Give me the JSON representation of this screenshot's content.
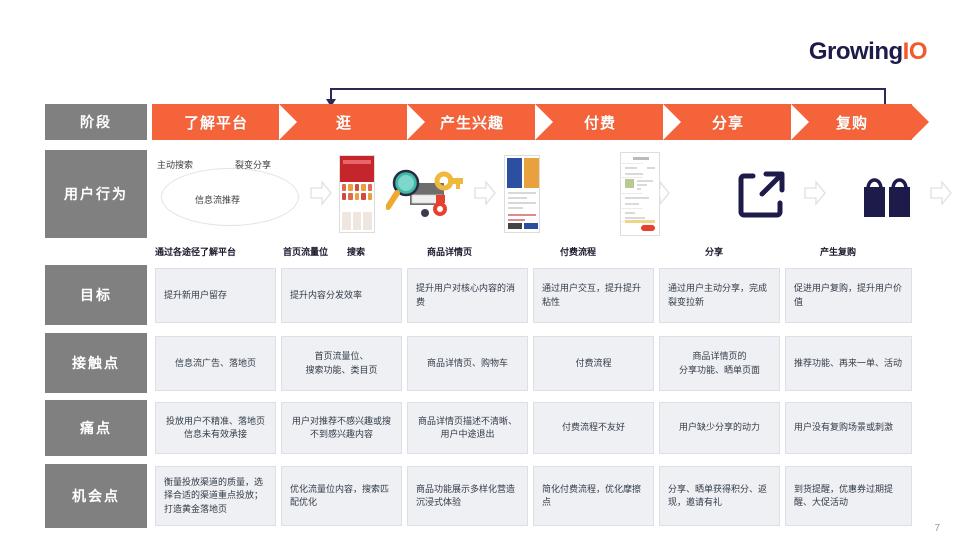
{
  "logo": {
    "part1": "Growing",
    "part2": "IO"
  },
  "page_number": "7",
  "row_labels": [
    {
      "name": "stage",
      "label": "阶段"
    },
    {
      "name": "behaviour",
      "label": "用户行为"
    },
    {
      "name": "goal",
      "label": "目标"
    },
    {
      "name": "touchpoint",
      "label": "接触点"
    },
    {
      "name": "painpoint",
      "label": "痛点"
    },
    {
      "name": "opportunity",
      "label": "机会点"
    }
  ],
  "stages": [
    "了解平台",
    "逛",
    "产生兴趣",
    "付费",
    "分享",
    "复购"
  ],
  "behaviour": {
    "bubble": {
      "t1": "主动搜索",
      "t2": "裂变分享",
      "t3": "信息流推荐"
    },
    "captions": [
      "通过各途径了解平台",
      "首页流量位",
      "搜索",
      "商品详情页",
      "付费流程",
      "分享",
      "产生复购"
    ],
    "icons": [
      "behaviour-bubble",
      "phone-homepage-mock",
      "search-key-illustration",
      "phone-product-detail-mock",
      "phone-payment-flow-mock",
      "share-external-link-icon",
      "shopping-bags-icon"
    ]
  },
  "rows": {
    "goal": [
      "提升新用户留存",
      "提升内容分发效率",
      "提升用户对核心内容的消费",
      "通过用户交互，提升提升粘性",
      "通过用户主动分享，完成裂变拉新",
      "促进用户复购，提升用户价值"
    ],
    "touchpoint": [
      "信息流广告、落地页",
      "首页流量位、\n搜索功能、类目页",
      "商品详情页、购物车",
      "付费流程",
      "商品详情页的\n分享功能、晒单页面",
      "推荐功能、再来一单、活动"
    ],
    "painpoint": [
      "投放用户不精准、落地页信息未有效承接",
      "用户对推荐不感兴趣或搜不到感兴趣内容",
      "商品详情页描述不清晰、用户中途退出",
      "付费流程不友好",
      "用户缺少分享的动力",
      "用户没有复购场景或刺激"
    ],
    "opportunity": [
      "衡量投放渠道的质量，选择合适的渠道重点投放；打造黄金落地页",
      "优化流量位内容，搜索匹配优化",
      "商品功能展示多样化营造沉浸式体验",
      "简化付费流程，优化摩擦点",
      "分享、晒单获得积分、返现，邀请有礼",
      "到货提醒，优惠券过期提醒、大促活动"
    ]
  },
  "row_alignment": {
    "goal": "left",
    "touchpoint": "center",
    "painpoint": "center",
    "opportunity": "left"
  },
  "colors": {
    "accent_orange": "#f4633a",
    "label_gray": "#808080",
    "cell_bg": "#eef0f4",
    "cell_border": "#dcdfe5",
    "logo_navy": "#1d1b4a",
    "loop_arrow": "#2b2a55"
  }
}
